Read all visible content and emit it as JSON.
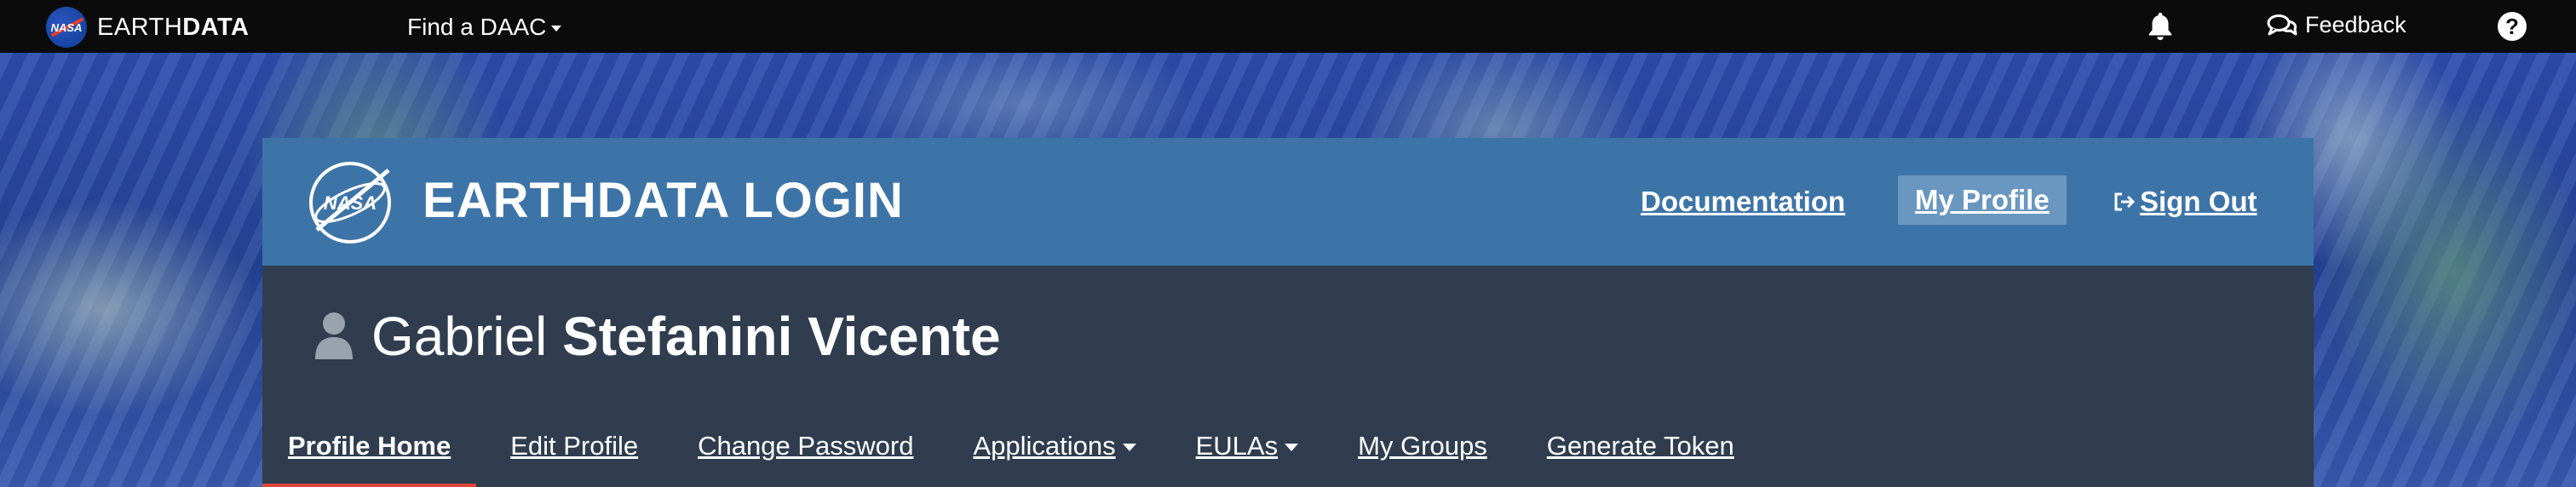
{
  "topnav": {
    "brand_light": "EARTH",
    "brand_bold": "DATA",
    "logo_text": "NASA",
    "find_daac": "Find a DAAC",
    "feedback": "Feedback",
    "help": "?"
  },
  "header": {
    "logo_text": "NASA",
    "title": "EARTHDATA LOGIN",
    "links": {
      "documentation": "Documentation",
      "my_profile": "My Profile",
      "sign_out": "Sign Out"
    }
  },
  "profile": {
    "first_name": "Gabriel",
    "last_name": "Stefanini Vicente"
  },
  "subnav": {
    "items": [
      {
        "label": "Profile Home",
        "active": true
      },
      {
        "label": "Edit Profile"
      },
      {
        "label": "Change Password"
      },
      {
        "label": "Applications",
        "dropdown": true
      },
      {
        "label": "EULAs",
        "dropdown": true
      },
      {
        "label": "My Groups"
      },
      {
        "label": "Generate Token"
      }
    ]
  },
  "colors": {
    "topnav_bg": "#0b0b0b",
    "header_bg": "#3d74a8",
    "profile_bg": "#2f3d4f",
    "active_tab_underline": "#e0453a",
    "my_profile_highlight": "#6a97c0"
  }
}
